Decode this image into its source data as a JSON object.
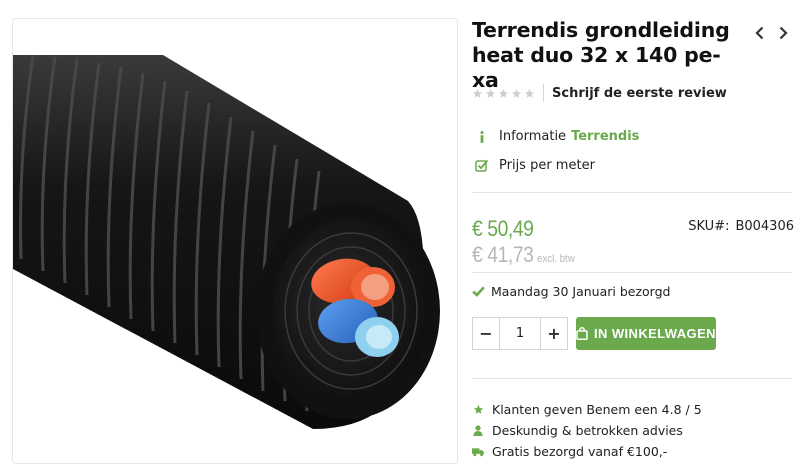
{
  "product": {
    "title": "Terrendis grondleiding heat duo 32 x 140 pe-xa",
    "review_link": "Schrijf de eerste review",
    "rating": 0,
    "rating_max": 5
  },
  "features": {
    "info_label": "Informatie",
    "brand": "Terrendis",
    "price_unit": "Prijs per meter"
  },
  "price": {
    "incl": "€ 50,49",
    "excl": "€ 41,73",
    "excl_note": "excl. btw",
    "sku_label": "SKU#:",
    "sku_value": "B004306"
  },
  "delivery": {
    "text": "Maandag 30 Januari bezorgd"
  },
  "cart": {
    "minus": "−",
    "plus": "+",
    "quantity": "1",
    "add_label": "IN WINKELWAGEN"
  },
  "usps": [
    {
      "icon": "star-icon",
      "text": "Klanten geven Benem een 4.8 / 5"
    },
    {
      "icon": "user-icon",
      "text": "Deskundig & betrokken advies"
    },
    {
      "icon": "truck-icon",
      "text": "Gratis bezorgd vanaf €100,-"
    }
  ],
  "colors": {
    "accent": "#6aaa4c",
    "muted_price": "#b7b7b7",
    "pipe_red": "#e9461e",
    "pipe_blue": "#3b7fd6",
    "pipe_light_blue": "#8fd0ee"
  }
}
